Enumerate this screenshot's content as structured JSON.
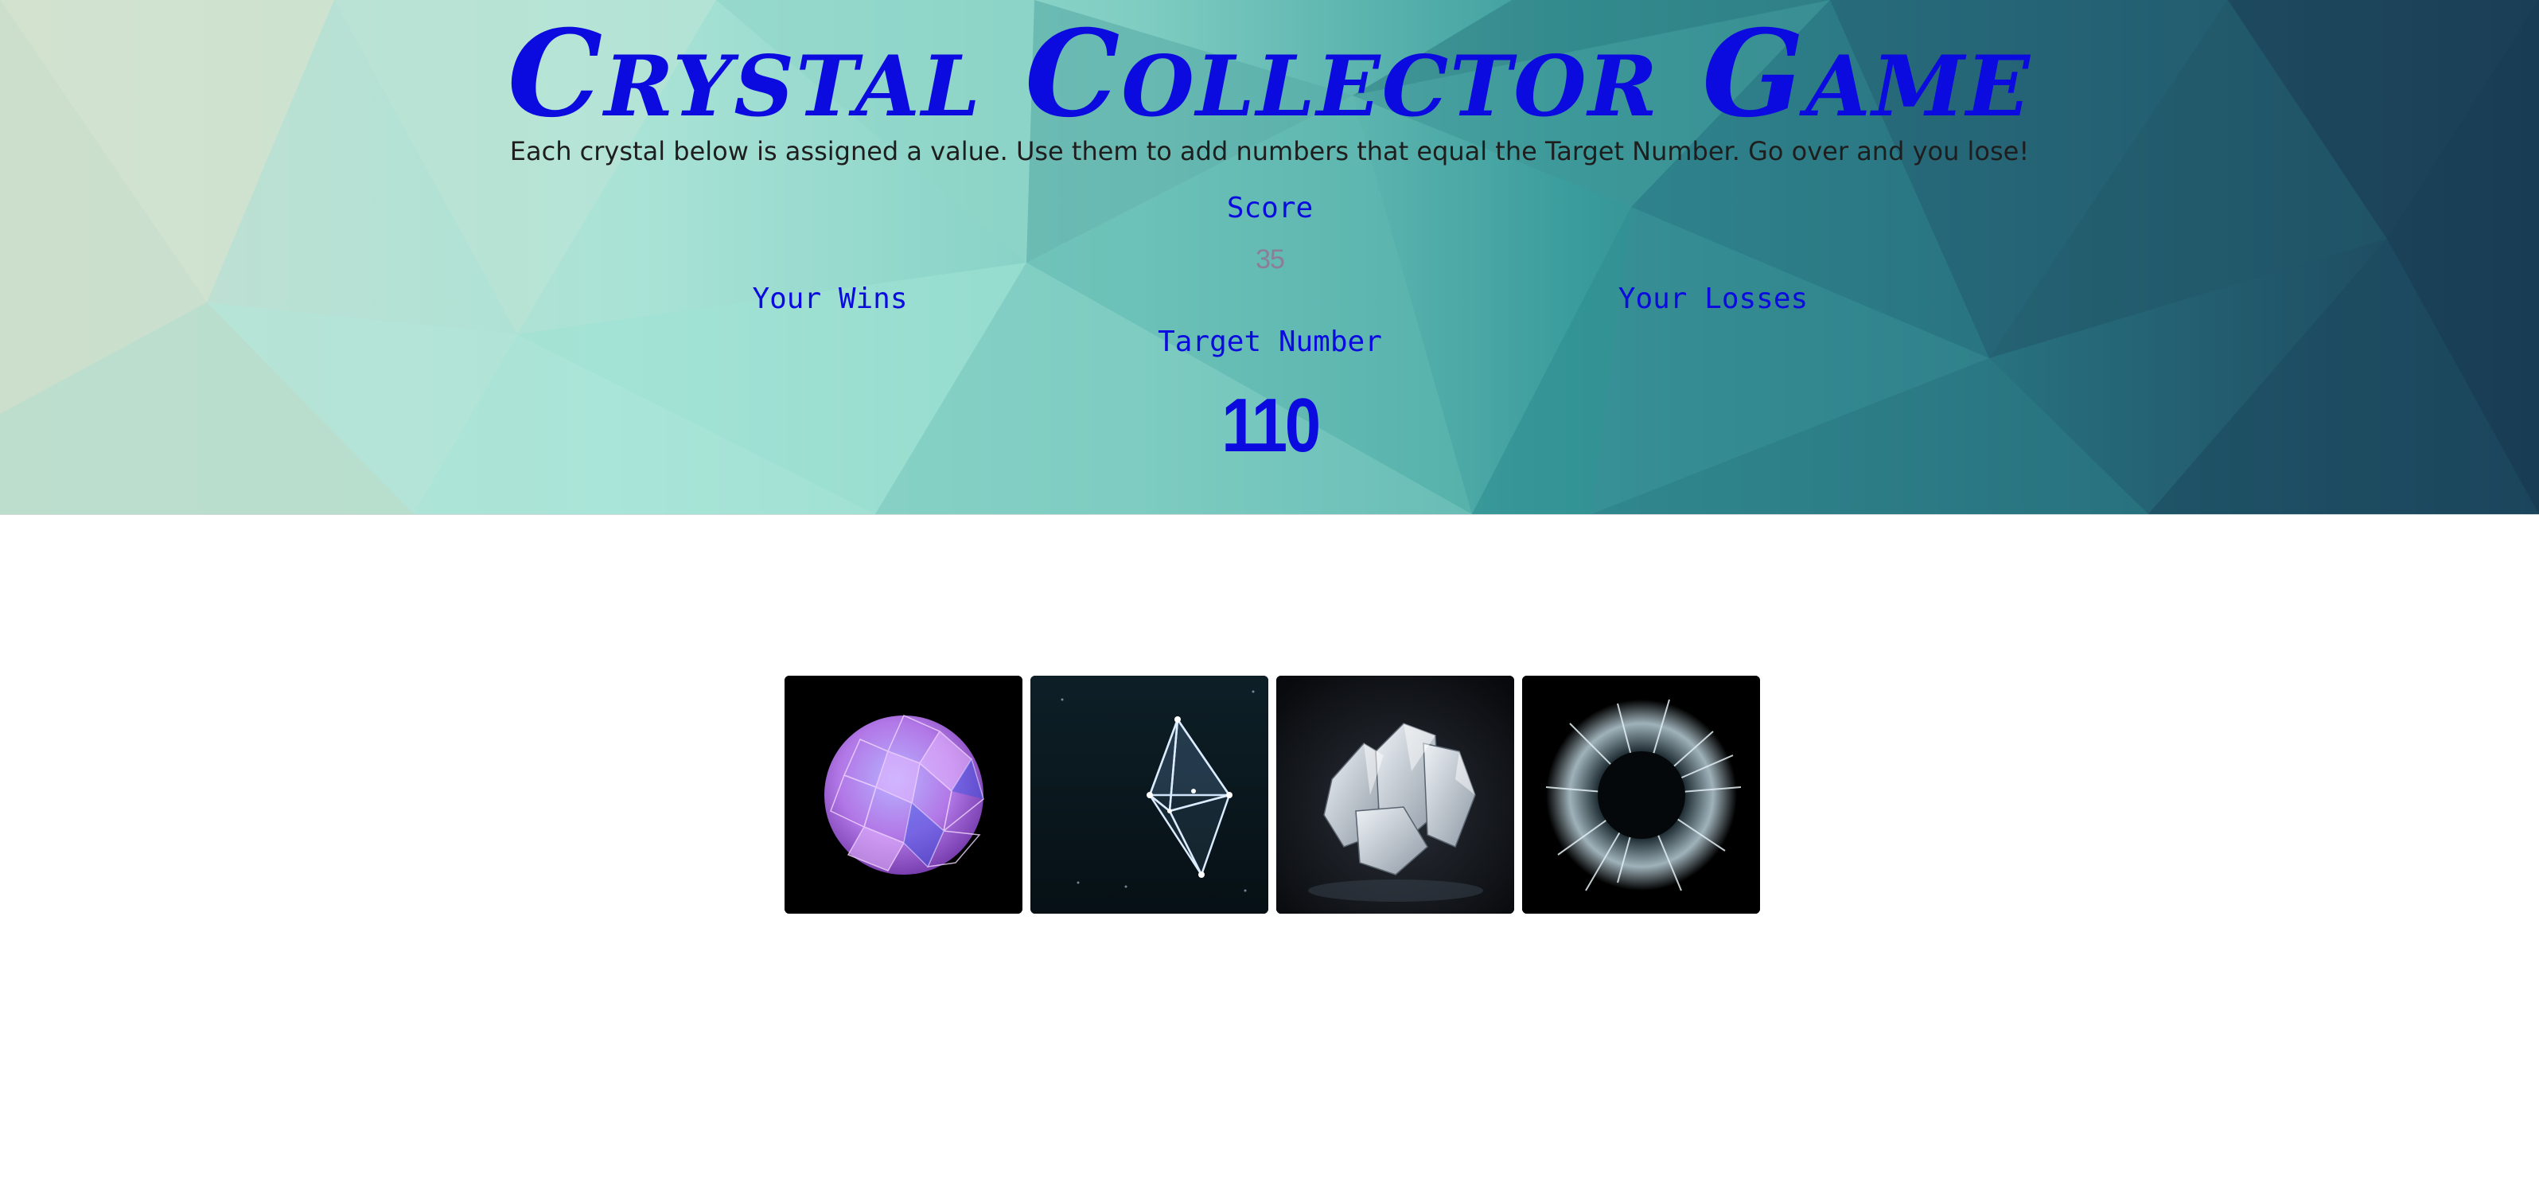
{
  "header": {
    "title": "Crystal Collector Game",
    "instructions": "Each crystal below is assigned a value. Use them to add numbers that equal the Target Number. Go over and you lose!"
  },
  "scoreboard": {
    "score_label": "Score",
    "score_value": "35",
    "wins_label": "Your Wins",
    "losses_label": "Your Losses",
    "target_label": "Target Number",
    "target_value": "110"
  },
  "crystals": [
    {
      "name": "purple-faceted-sphere-crystal"
    },
    {
      "name": "glowing-octahedron-crystal"
    },
    {
      "name": "white-quartz-cluster-crystal"
    },
    {
      "name": "spiky-burst-crystal"
    }
  ],
  "colors": {
    "accent": "#0b0be0",
    "body_text": "#1e1e1e",
    "score_value": "#8a7f94",
    "hero_light": "#a6e3d6",
    "hero_dark": "#1c4459"
  }
}
